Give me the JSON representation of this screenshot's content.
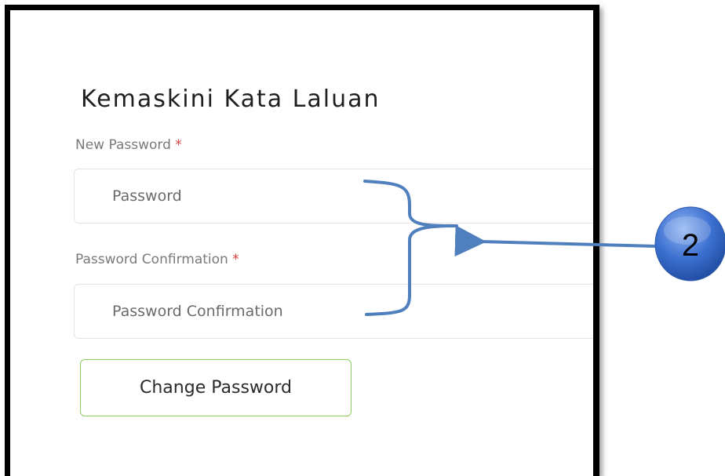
{
  "form": {
    "title": "Kemaskini Kata Laluan",
    "new_password_label": "New Password",
    "new_password_required": "*",
    "new_password_placeholder": "Password",
    "confirm_label": "Password Confirmation",
    "confirm_required": "*",
    "confirm_placeholder": "Password Confirmation",
    "submit_label": "Change Password"
  },
  "annotation": {
    "badge_number": "2"
  },
  "colors": {
    "frame_border": "#000000",
    "button_border": "#8fcc63",
    "required_star": "#e0403c",
    "annotation_stroke": "#4f7fbd",
    "badge_fill": "#3b6fd0"
  }
}
